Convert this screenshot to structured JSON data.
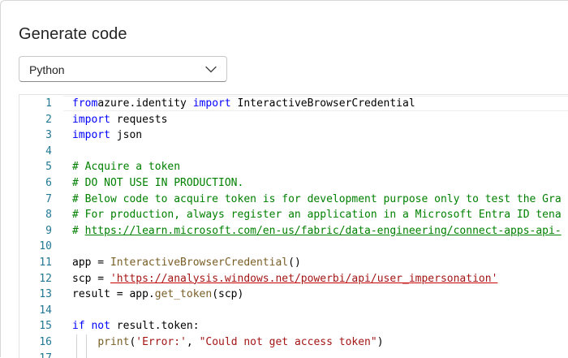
{
  "title": "Generate code",
  "language_select": {
    "value": "Python",
    "icon": "chevron-down-icon"
  },
  "lines": [
    {
      "n": "1",
      "parts": [
        [
          "kw",
          "from"
        ],
        [
          "",
          "azure.identity "
        ],
        [
          "kw",
          "import"
        ],
        [
          "",
          " InteractiveBrowserCredential"
        ]
      ]
    },
    {
      "n": "2",
      "parts": [
        [
          "kw",
          "import"
        ],
        [
          "",
          " requests"
        ]
      ]
    },
    {
      "n": "3",
      "parts": [
        [
          "kw",
          "import"
        ],
        [
          "",
          " json"
        ]
      ]
    },
    {
      "n": "4",
      "parts": []
    },
    {
      "n": "5",
      "parts": [
        [
          "cm",
          "# Acquire a token"
        ]
      ]
    },
    {
      "n": "6",
      "parts": [
        [
          "cm",
          "# DO NOT USE IN PRODUCTION."
        ]
      ]
    },
    {
      "n": "7",
      "parts": [
        [
          "cm",
          "# Below code to acquire token is for development purpose only to test the Gra"
        ]
      ]
    },
    {
      "n": "8",
      "parts": [
        [
          "cm",
          "# For production, always register an application in a Microsoft Entra ID tena"
        ]
      ]
    },
    {
      "n": "9",
      "parts": [
        [
          "cm",
          "# "
        ],
        [
          "cm url",
          "https://learn.microsoft.com/en-us/fabric/data-engineering/connect-apps-api-"
        ]
      ]
    },
    {
      "n": "10",
      "parts": []
    },
    {
      "n": "11",
      "parts": [
        [
          "",
          "app = "
        ],
        [
          "fn",
          "InteractiveBrowserCredential"
        ],
        [
          "",
          "()"
        ]
      ]
    },
    {
      "n": "12",
      "parts": [
        [
          "",
          "scp = "
        ],
        [
          "st squig",
          "'https://analysis.windows.net/powerbi/api/user_impersonation'"
        ]
      ]
    },
    {
      "n": "13",
      "parts": [
        [
          "",
          "result = app."
        ],
        [
          "fn",
          "get_token"
        ],
        [
          "",
          "(scp)"
        ]
      ]
    },
    {
      "n": "14",
      "parts": []
    },
    {
      "n": "15",
      "parts": [
        [
          "kw",
          "if"
        ],
        [
          "",
          " "
        ],
        [
          "kw",
          "not"
        ],
        [
          "",
          " result.token:"
        ]
      ]
    },
    {
      "n": "16",
      "parts": [
        [
          "",
          "    "
        ],
        [
          "fn",
          "print"
        ],
        [
          "",
          "("
        ],
        [
          "st",
          "'Error:'"
        ],
        [
          "",
          ", "
        ],
        [
          "st",
          "\"Could not get access token\""
        ],
        [
          "",
          ")"
        ]
      ]
    },
    {
      "n": "17",
      "parts": []
    }
  ]
}
